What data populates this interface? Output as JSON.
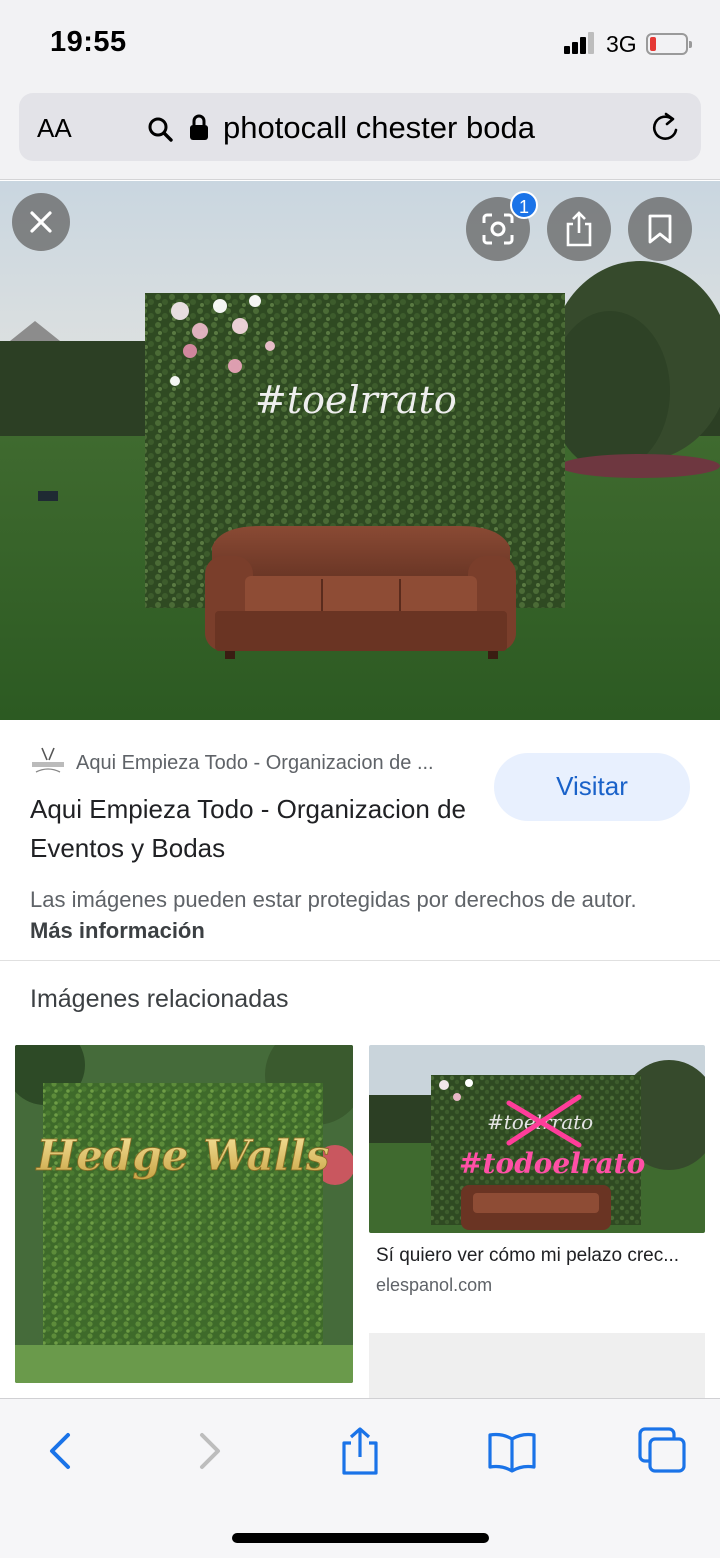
{
  "status_bar": {
    "time": "19:55",
    "network": "3G"
  },
  "url_bar": {
    "aa_label": "AA",
    "url_text": "photocall chester boda"
  },
  "hero": {
    "neon_text": "#toelrrato",
    "share_badge_count": "1"
  },
  "result": {
    "source_name": "Aqui Empieza Todo - Organizacion de ...",
    "title": "Aqui Empieza Todo - Organizacion de Eventos y Bodas",
    "visit_label": "Visitar",
    "copyright_text": "Las imágenes pueden estar protegidas por derechos de autor.",
    "more_info_label": "Más información"
  },
  "related": {
    "heading": "Imágenes relacionadas",
    "items": [
      {
        "image_text": "Hedge Walls"
      },
      {
        "image_text_top": "#toelrrato",
        "image_text_main": "#todoelrato",
        "title": "Sí quiero ver cómo mi pelazo crec...",
        "source": "elespanol.com"
      }
    ]
  },
  "toolbar": {
    "icons": [
      "back-icon",
      "forward-icon",
      "share-icon",
      "bookmarks-icon",
      "tabs-icon"
    ]
  },
  "colors": {
    "accent": "#1a73e8",
    "visit_bg": "#e8f0fe",
    "neon_pink": "#ff3d9a"
  }
}
